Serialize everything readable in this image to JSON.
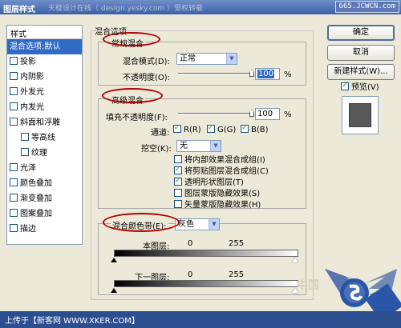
{
  "window": {
    "title": "图层样式",
    "watermark": "天极设计在线（ design.yesky.com ）受权转载",
    "site_badge": "665.JCWCN.com"
  },
  "sidebar": {
    "header": "样式",
    "items": [
      {
        "label": "混合选项:默认",
        "selected": true,
        "checkbox": false
      },
      {
        "label": "投影",
        "checkbox": true
      },
      {
        "label": "内阴影",
        "checkbox": true
      },
      {
        "label": "外发光",
        "checkbox": true
      },
      {
        "label": "内发光",
        "checkbox": true
      },
      {
        "label": "斜面和浮雕",
        "checkbox": true
      },
      {
        "label": "等高线",
        "checkbox": true,
        "indent": true
      },
      {
        "label": "纹理",
        "checkbox": true,
        "indent": true
      },
      {
        "label": "光泽",
        "checkbox": true
      },
      {
        "label": "颜色叠加",
        "checkbox": true
      },
      {
        "label": "渐变叠加",
        "checkbox": true
      },
      {
        "label": "图案叠加",
        "checkbox": true
      },
      {
        "label": "描边",
        "checkbox": true
      }
    ]
  },
  "main": {
    "group_title": "混合选项",
    "general": {
      "legend": "常规混合",
      "mode_label": "混合模式(D):",
      "mode_value": "正常",
      "opacity_label": "不透明度(O):",
      "opacity_value": "100",
      "opacity_unit": "%",
      "opacity_fraction": 1.0
    },
    "advanced": {
      "legend": "高级混合",
      "fill_label": "填充不透明度(F):",
      "fill_value": "100",
      "fill_unit": "%",
      "fill_fraction": 1.0,
      "channels_label": "通道:",
      "channels": [
        {
          "label": "R(R)",
          "checked": true
        },
        {
          "label": "G(G)",
          "checked": true
        },
        {
          "label": "B(B)",
          "checked": true
        }
      ],
      "knockout_label": "挖空(K):",
      "knockout_value": "无",
      "options": [
        {
          "label": "将内部效果混合成组(I)",
          "checked": false
        },
        {
          "label": "将剪贴图层混合成组(C)",
          "checked": true
        },
        {
          "label": "透明形状图层(T)",
          "checked": true
        },
        {
          "label": "图层蒙版隐藏效果(S)",
          "checked": false
        },
        {
          "label": "矢量蒙版隐藏效果(H)",
          "checked": false
        }
      ]
    },
    "blend_if": {
      "label": "混合颜色带(E):",
      "value": "灰色",
      "this_layer_label": "本图层:",
      "this_layer_low": "0",
      "this_layer_high": "255",
      "underlying_label": "下一图层:",
      "underlying_low": "0",
      "underlying_high": "255"
    }
  },
  "buttons": {
    "ok": "确定",
    "cancel": "取消",
    "new_style": "新建样式(W)...",
    "preview_label": "预览(V)",
    "preview_checked": true
  },
  "footer": {
    "text": "上传于【新客网 WWW.XKER.COM】",
    "bg_watermark": "中国"
  }
}
